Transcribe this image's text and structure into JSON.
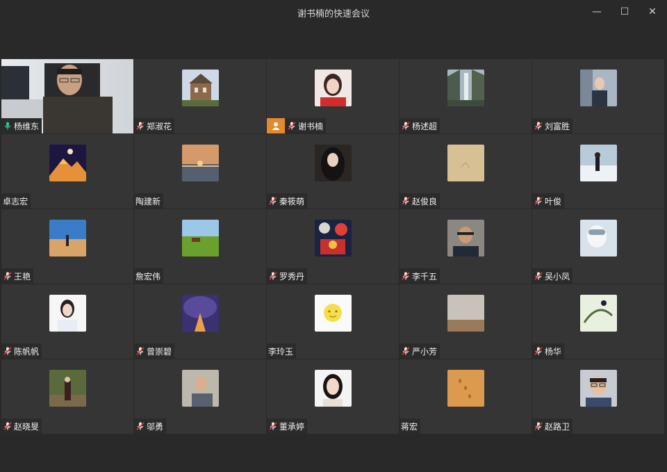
{
  "window": {
    "title": "谢书楠的快速会议",
    "minimize_label": "—",
    "maximize_label": "☐",
    "close_label": "✕"
  },
  "participants": [
    {
      "name": "杨维东",
      "mic": "speaking",
      "video": true
    },
    {
      "name": "郑淑花",
      "mic": "muted",
      "avatar": "castle-photo"
    },
    {
      "name": "谢书楠",
      "mic": "muted",
      "avatar": "woman-red-photo",
      "host": true
    },
    {
      "name": "杨述超",
      "mic": "muted",
      "avatar": "mountain-waterfall-photo"
    },
    {
      "name": "刘富胜",
      "mic": "muted",
      "avatar": "man-office-photo"
    },
    {
      "name": "卓志宏",
      "mic": "none",
      "avatar": "mountain-moon-photo"
    },
    {
      "name": "陶建新",
      "mic": "none",
      "avatar": "sunset-sea-photo"
    },
    {
      "name": "秦筱萌",
      "mic": "muted",
      "avatar": "woman-dark-hair-photo"
    },
    {
      "name": "赵俊良",
      "mic": "muted",
      "avatar": "paper-texture-photo"
    },
    {
      "name": "叶俊",
      "mic": "muted",
      "avatar": "snow-person-photo"
    },
    {
      "name": "王艳",
      "mic": "muted",
      "avatar": "desert-walker-photo"
    },
    {
      "name": "詹宏伟",
      "mic": "none",
      "avatar": "grassland-horse-photo"
    },
    {
      "name": "罗秀丹",
      "mic": "muted",
      "avatar": "colorful-art-photo"
    },
    {
      "name": "李千五",
      "mic": "muted",
      "avatar": "man-portrait-photo"
    },
    {
      "name": "吴小凤",
      "mic": "muted",
      "avatar": "girl-goggles-photo"
    },
    {
      "name": "陈帆帆",
      "mic": "muted",
      "avatar": "woman-id-photo"
    },
    {
      "name": "曾崇碧",
      "mic": "muted",
      "avatar": "tree-tunnel-photo"
    },
    {
      "name": "李玲玉",
      "mic": "none",
      "avatar": "sun-emoji-photo"
    },
    {
      "name": "严小芳",
      "mic": "muted",
      "avatar": "foggy-field-photo"
    },
    {
      "name": "杨华",
      "mic": "muted",
      "avatar": "ink-painting-photo"
    },
    {
      "name": "赵晓旻",
      "mic": "muted",
      "avatar": "woman-outdoor-photo"
    },
    {
      "name": "邬勇",
      "mic": "muted",
      "avatar": "man-room-photo"
    },
    {
      "name": "董承婷",
      "mic": "muted",
      "avatar": "woman-portrait-photo"
    },
    {
      "name": "蒋宏",
      "mic": "none",
      "avatar": "beach-footprints-photo"
    },
    {
      "name": "赵路卫",
      "mic": "muted",
      "avatar": "man-glasses-photo"
    }
  ],
  "colors": {
    "background": "#292929",
    "tile": "#353535",
    "active_border": "#22c38e",
    "host_badge": "#e48a2e",
    "mic_muted": "#e03a3a"
  }
}
